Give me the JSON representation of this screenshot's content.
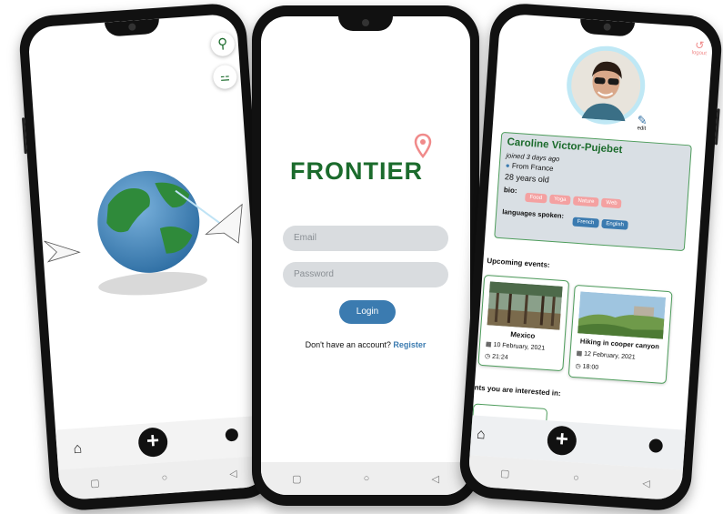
{
  "phone1": {
    "search_icon": "search-icon",
    "tag_icon": "tag-icon",
    "fab_label": "+"
  },
  "phone2": {
    "brand": "FRONTIER",
    "email_placeholder": "Email",
    "password_placeholder": "Password",
    "login_label": "Login",
    "no_account_text": "Don't have an account?",
    "register_label": "Register"
  },
  "phone3": {
    "logout_label": "logout",
    "edit_label": "edit",
    "name": "Caroline Victor-Pujebet",
    "joined": "joined 3 days ago",
    "from": "From France",
    "age": "28 years old",
    "bio_label": "bio:",
    "bio_tags": [
      "Food",
      "Yoga",
      "Nature",
      "Web"
    ],
    "languages_label": "languages spoken:",
    "languages": [
      "French",
      "English"
    ],
    "upcoming_title": "Upcoming events:",
    "events": [
      {
        "title": "Mexico",
        "date": "10 February, 2021",
        "time": "21:24"
      },
      {
        "title": "Hiking in cooper canyon",
        "date": "12 February, 2021",
        "time": "18:00"
      }
    ],
    "interested_title": "nts you are interested in:",
    "fab_label": "+"
  },
  "colors": {
    "brand_green": "#1b6b2c",
    "accent_blue": "#3b7bb0",
    "tag_pink": "#f4a1a1",
    "card_border": "#4d9c5b"
  }
}
